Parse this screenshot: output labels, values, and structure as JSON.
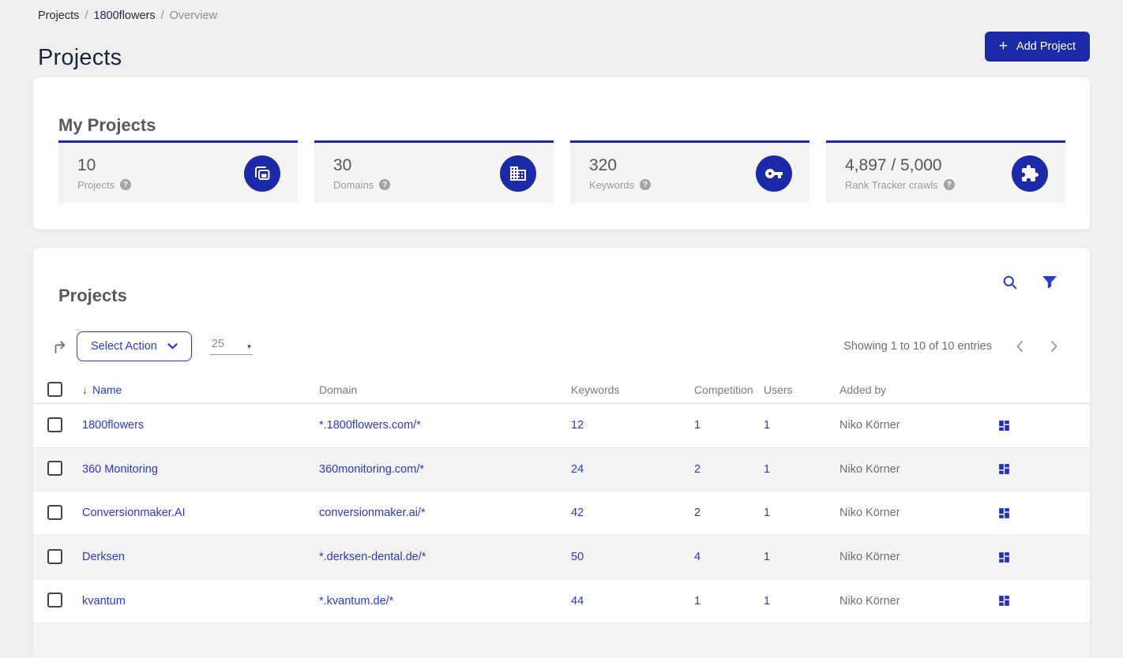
{
  "breadcrumb": {
    "separator": "/",
    "items": [
      {
        "label": "Projects"
      },
      {
        "label": "1800flowers"
      },
      {
        "label": "Overview"
      }
    ]
  },
  "header": {
    "title": "Projects",
    "add_project_label": "Add Project"
  },
  "icons": {
    "plus_glyph": "+",
    "help_glyph": "?",
    "sort_desc_glyph": "↓",
    "caret_down_glyph": "▾"
  },
  "my_projects": {
    "title": "My Projects",
    "cards": [
      {
        "value": "10",
        "label": "Projects",
        "icon": "projects-copy-icon"
      },
      {
        "value": "30",
        "label": "Domains",
        "icon": "building-icon"
      },
      {
        "value": "320",
        "label": "Keywords",
        "icon": "key-icon"
      },
      {
        "value": "4,897 / 5,000",
        "label": "Rank Tracker crawls",
        "icon": "puzzle-icon"
      }
    ]
  },
  "projects_table": {
    "title": "Projects",
    "toolbar": {
      "select_action_label": "Select Action",
      "page_size": "25",
      "showing_text": "Showing 1 to 10 of 10 entries"
    },
    "columns": {
      "name": "Name",
      "domain": "Domain",
      "keywords": "Keywords",
      "competition": "Competition",
      "users": "Users",
      "added_by": "Added by"
    },
    "rows": [
      {
        "name": "1800flowers",
        "domain": "*.1800flowers.com/*",
        "keywords": "12",
        "competition": "1",
        "users": "1",
        "added_by": "Niko Körner"
      },
      {
        "name": "360 Monitoring",
        "domain": "360monitoring.com/*",
        "keywords": "24",
        "competition": "2",
        "users": "1",
        "added_by": "Niko Körner"
      },
      {
        "name": "Conversionmaker.AI",
        "domain": "conversionmaker.ai/*",
        "keywords": "42",
        "competition": "2",
        "users": "1",
        "added_by": "Niko Körner"
      },
      {
        "name": "Derksen",
        "domain": "*.derksen-dental.de/*",
        "keywords": "50",
        "competition": "4",
        "users": "1",
        "added_by": "Niko Körner"
      },
      {
        "name": "kvantum",
        "domain": "*.kvantum.de/*",
        "keywords": "44",
        "competition": "1",
        "users": "1",
        "added_by": "Niko Körner"
      }
    ]
  },
  "colors": {
    "primary_blue": "#1b2aa6",
    "link_blue": "#2b39cf",
    "page_background": "#efeff0",
    "stat_card_background": "#f4f4f5"
  }
}
